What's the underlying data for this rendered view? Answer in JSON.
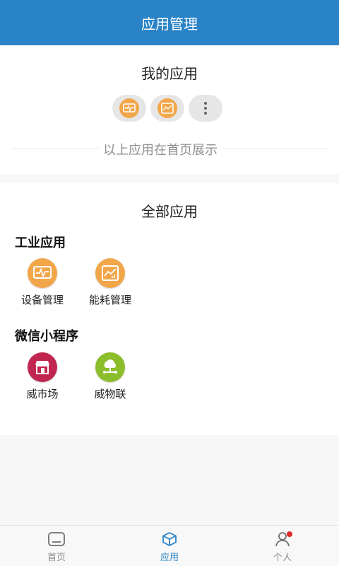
{
  "header": {
    "title": "应用管理"
  },
  "my_apps": {
    "title": "我的应用",
    "icons": [
      "device-monitor-icon",
      "energy-chart-icon",
      "more-icon"
    ],
    "hint": "以上应用在首页展示"
  },
  "all_apps": {
    "title": "全部应用",
    "groups": [
      {
        "title": "工业应用",
        "items": [
          {
            "label": "设备管理",
            "icon": "device-monitor-icon",
            "color": "#f2a64a"
          },
          {
            "label": "能耗管理",
            "icon": "energy-chart-icon",
            "color": "#f2a64a"
          }
        ]
      },
      {
        "title": "微信小程序",
        "items": [
          {
            "label": "威市场",
            "icon": "market-store-icon",
            "color": "#c0264f"
          },
          {
            "label": "威物联",
            "icon": "iot-cloud-icon",
            "color": "#8cbd2a"
          }
        ]
      }
    ]
  },
  "tabbar": {
    "tabs": [
      {
        "label": "首页",
        "icon": "home-icon"
      },
      {
        "label": "应用",
        "icon": "cube-icon",
        "active": true
      },
      {
        "label": "个人",
        "icon": "person-icon",
        "badge": true
      }
    ],
    "accent": "#2a83c6"
  }
}
